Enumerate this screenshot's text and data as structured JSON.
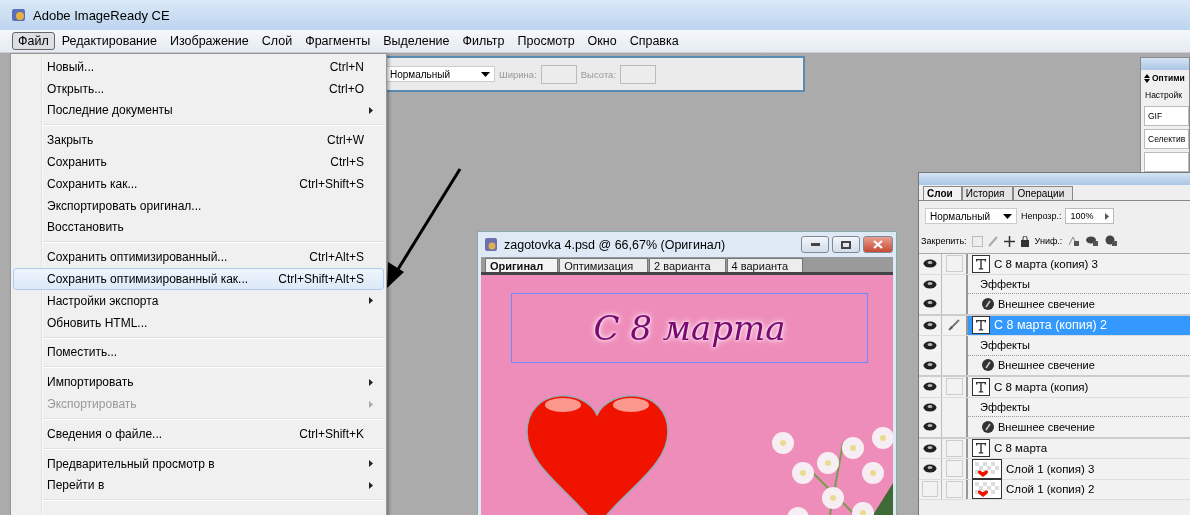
{
  "app": {
    "title": "Adobe ImageReady CE"
  },
  "menu_bar": [
    {
      "label": "Файл",
      "selected": true
    },
    {
      "label": "Редактирование",
      "selected": false
    },
    {
      "label": "Изображение",
      "selected": false
    },
    {
      "label": "Слой",
      "selected": false
    },
    {
      "label": "Фрагменты",
      "selected": false
    },
    {
      "label": "Выделение",
      "selected": false
    },
    {
      "label": "Фильтр",
      "selected": false
    },
    {
      "label": "Просмотр",
      "selected": false
    },
    {
      "label": "Окно",
      "selected": false
    },
    {
      "label": "Справка",
      "selected": false
    }
  ],
  "file_menu": {
    "groups": [
      [
        {
          "label": "Новый...",
          "shortcut": "Ctrl+N",
          "submenu": false,
          "disabled": false,
          "selected": false
        },
        {
          "label": "Открыть...",
          "shortcut": "Ctrl+O",
          "submenu": false,
          "disabled": false,
          "selected": false
        },
        {
          "label": "Последние документы",
          "submenu": true,
          "disabled": false,
          "selected": false
        }
      ],
      [
        {
          "label": "Закрыть",
          "shortcut": "Ctrl+W",
          "submenu": false,
          "disabled": false,
          "selected": false
        },
        {
          "label": "Сохранить",
          "shortcut": "Ctrl+S",
          "submenu": false,
          "disabled": false,
          "selected": false
        },
        {
          "label": "Сохранить как...",
          "shortcut": "Ctrl+Shift+S",
          "submenu": false,
          "disabled": false,
          "selected": false
        },
        {
          "label": "Экспортировать оригинал...",
          "submenu": false,
          "disabled": false,
          "selected": false
        },
        {
          "label": "Восстановить",
          "submenu": false,
          "disabled": false,
          "selected": false
        }
      ],
      [
        {
          "label": "Сохранить оптимизированный...",
          "shortcut": "Ctrl+Alt+S",
          "submenu": false,
          "disabled": false,
          "selected": false
        },
        {
          "label": "Сохранить оптимизированный как...",
          "shortcut": "Ctrl+Shift+Alt+S",
          "submenu": false,
          "disabled": false,
          "selected": true
        },
        {
          "label": "Настройки экспорта",
          "submenu": true,
          "disabled": false,
          "selected": false
        },
        {
          "label": "Обновить HTML...",
          "submenu": false,
          "disabled": false,
          "selected": false
        }
      ],
      [
        {
          "label": "Поместить...",
          "submenu": false,
          "disabled": false,
          "selected": false
        }
      ],
      [
        {
          "label": "Импортировать",
          "submenu": true,
          "disabled": false,
          "selected": false
        },
        {
          "label": "Экспортировать",
          "submenu": true,
          "disabled": true,
          "selected": false
        }
      ],
      [
        {
          "label": "Сведения о файле...",
          "shortcut": "Ctrl+Shift+K",
          "submenu": false,
          "disabled": false,
          "selected": false
        }
      ],
      [
        {
          "label": "Предварительный просмотр в",
          "submenu": true,
          "disabled": false,
          "selected": false
        },
        {
          "label": "Перейти в",
          "submenu": true,
          "disabled": false,
          "selected": false
        }
      ]
    ]
  },
  "options_bar": {
    "blend_mode": "Нормальный",
    "width_field": {
      "label": "Ширина:",
      "disabled": true
    },
    "height_field": {
      "label": "Высота:",
      "disabled": true
    }
  },
  "optimize_panel": {
    "tab": "Оптими",
    "settings_label": "Настройк",
    "format": "GIF",
    "palette": "Селектив"
  },
  "layers_panel": {
    "tabs": [
      {
        "label": "Слои",
        "selected": true
      },
      {
        "label": "История",
        "selected": false
      },
      {
        "label": "Операции",
        "selected": false
      }
    ],
    "blend_mode": "Нормальный",
    "opacity_label": "Непрозр.:",
    "opacity": "100%",
    "lock_label": "Закрепить:",
    "unify_label": "Униф.:",
    "layers": [
      {
        "kind": "text",
        "name": "С 8 марта (копия) 3",
        "visible": true,
        "selected": false,
        "children": [
          {
            "kind": "effects",
            "name": "Эффекты",
            "visible": true,
            "children": [
              {
                "kind": "effect",
                "name": "Внешнее свечение",
                "visible": true
              }
            ]
          }
        ]
      },
      {
        "kind": "text",
        "name": "С 8 марта (копия) 2",
        "visible": true,
        "selected": true,
        "children": [
          {
            "kind": "effects",
            "name": "Эффекты",
            "visible": true,
            "children": [
              {
                "kind": "effect",
                "name": "Внешнее свечение",
                "visible": true
              }
            ]
          }
        ]
      },
      {
        "kind": "text",
        "name": "С 8 марта (копия)",
        "visible": true,
        "selected": false,
        "children": [
          {
            "kind": "effects",
            "name": "Эффекты",
            "visible": true,
            "children": [
              {
                "kind": "effect",
                "name": "Внешнее свечение",
                "visible": true
              }
            ]
          }
        ]
      },
      {
        "kind": "text",
        "name": "С 8 марта",
        "visible": true,
        "selected": false
      },
      {
        "kind": "image",
        "name": "Слой 1 (копия) 3",
        "visible": true,
        "selected": false
      },
      {
        "kind": "image",
        "name": "Слой 1 (копия) 2",
        "visible": false,
        "selected": false
      }
    ]
  },
  "document": {
    "title": "zagotovka 4.psd @ 66,67% (Оригинал)",
    "tabs": [
      {
        "label": "Оригинал",
        "selected": true
      },
      {
        "label": "Оптимизация",
        "selected": false
      },
      {
        "label": "2 варианта",
        "selected": false
      },
      {
        "label": "4 варианта",
        "selected": false
      }
    ],
    "canvas_text": "С 8 марта"
  }
}
